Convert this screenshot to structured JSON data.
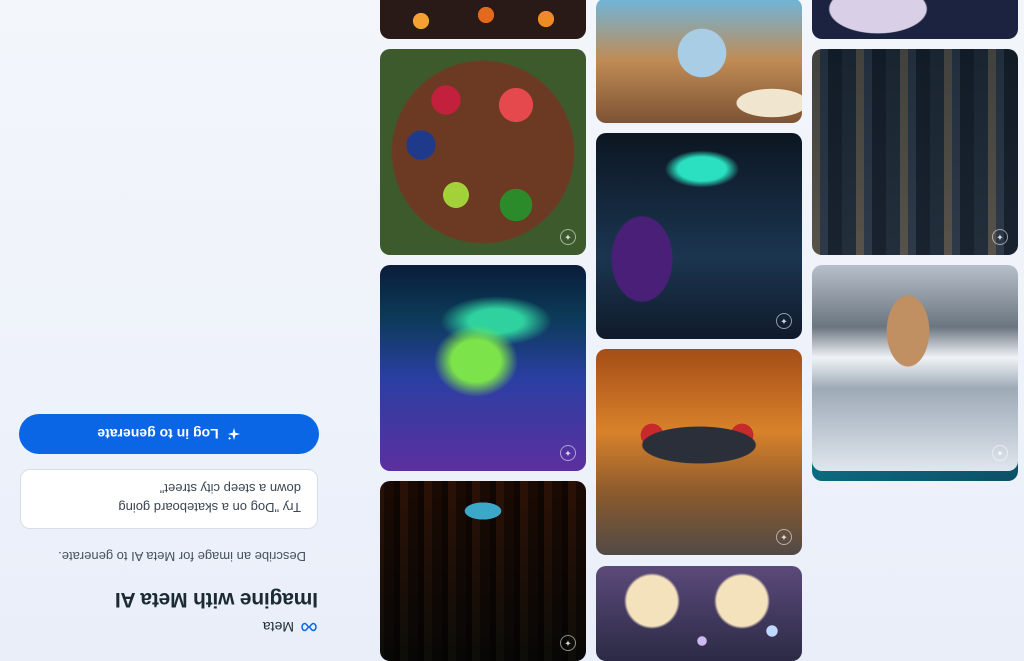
{
  "brand": {
    "name": "Meta"
  },
  "hero": {
    "title": "Imagine with Meta AI",
    "subtitle": "Describe an image for Meta AI to generate.",
    "prompt_example_line1": "Try \"Dog on a skateboard going",
    "prompt_example_line2": "down a steep city street\"",
    "login_button": "Log in to generate"
  },
  "icons": {
    "brand_logo": "meta-infinity-icon",
    "login": "sparkle-icon",
    "tile_badge": "sparkle-badge-icon"
  },
  "colors": {
    "primary_button": "#0a66e4",
    "title_text": "#1c2b33",
    "background": "#eef2fa"
  },
  "gallery": {
    "tiles": [
      "butterfly",
      "dog-in-clouds",
      "city-towers",
      "night-sky",
      "bubble-ducks",
      "desert-car",
      "neon-figures",
      "bird-on-dock",
      "library",
      "aurora",
      "fruit-bowl",
      "lanterns"
    ]
  }
}
